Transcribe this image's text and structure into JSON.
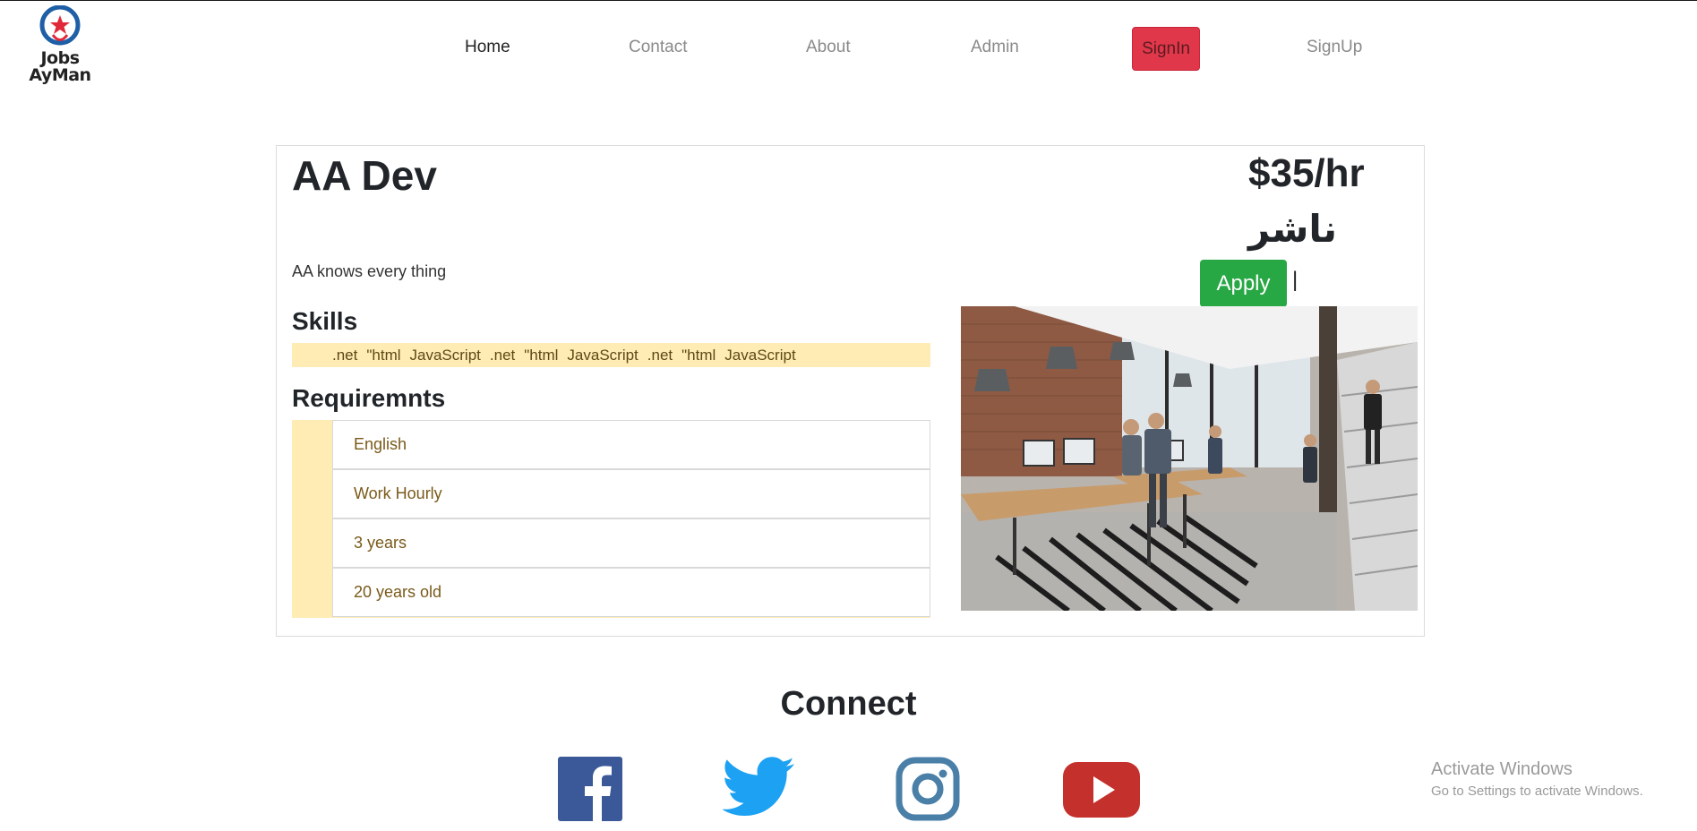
{
  "logo": {
    "line1": "Jobs",
    "line2": "AyMan"
  },
  "nav": {
    "home": "Home",
    "contact": "Contact",
    "about": "About",
    "admin": "Admin",
    "signin": "SignIn",
    "signup": "SignUp"
  },
  "job": {
    "title": "AA Dev",
    "description": "AA knows every thing",
    "rate": "$35/hr",
    "publisher": "ناشر",
    "apply_label": "Apply",
    "apply_separator": "|",
    "skills_heading": "Skills",
    "skills": [
      ".net",
      "\"html",
      "JavaScript",
      ".net",
      "\"html",
      "JavaScript",
      ".net",
      "\"html",
      "JavaScript"
    ],
    "requirements_heading": "Requiremnts",
    "requirements": [
      "English",
      "Work Hourly",
      "3 years",
      "20 years old"
    ]
  },
  "footer": {
    "connect_title": "Connect",
    "social": [
      "facebook-icon",
      "twitter-icon",
      "instagram-icon",
      "youtube-icon"
    ]
  },
  "watermark": {
    "title": "Activate Windows",
    "subtitle": "Go to Settings to activate Windows."
  },
  "colors": {
    "signin_bg": "#e0384a",
    "apply_bg": "#28a745",
    "highlight_bg": "#ffecb5"
  }
}
